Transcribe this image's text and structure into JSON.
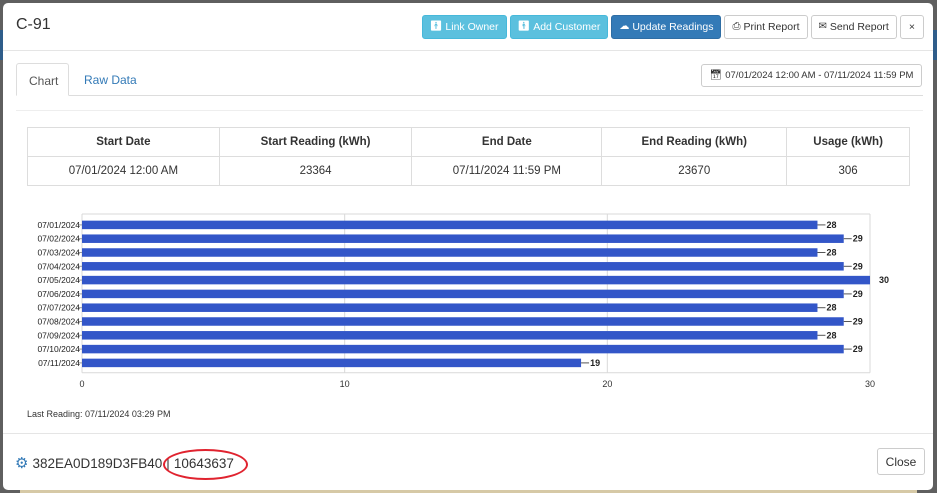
{
  "modal": {
    "title": "C-91"
  },
  "header_buttons": {
    "link_owner": "Link Owner",
    "add_customer": "Add Customer",
    "update_readings": "Update Readings",
    "print_report": "Print Report",
    "send_report": "Send Report",
    "close_x": "×"
  },
  "tabs": [
    {
      "label": "Chart",
      "active": true
    },
    {
      "label": "Raw Data",
      "active": false
    }
  ],
  "date_range": "07/01/2024 12:00 AM - 07/11/2024 11:59 PM",
  "summary": {
    "headers": [
      "Start Date",
      "Start Reading (kWh)",
      "End Date",
      "End Reading (kWh)",
      "Usage (kWh)"
    ],
    "row": [
      "07/01/2024 12:00 AM",
      "23364",
      "07/11/2024 11:59 PM",
      "23670",
      "306"
    ]
  },
  "chart_data": {
    "type": "bar",
    "orientation": "horizontal",
    "categories": [
      "07/01/2024",
      "07/02/2024",
      "07/03/2024",
      "07/04/2024",
      "07/05/2024",
      "07/06/2024",
      "07/07/2024",
      "07/08/2024",
      "07/09/2024",
      "07/10/2024",
      "07/11/2024"
    ],
    "values": [
      28,
      29,
      28,
      29,
      30,
      29,
      28,
      29,
      28,
      29,
      19
    ],
    "xlim": [
      0,
      30
    ],
    "xticks": [
      0,
      10,
      20,
      30
    ],
    "grid": true,
    "bar_color": "#3356c8"
  },
  "last_reading": "Last Reading: 07/11/2024 03:29 PM",
  "footer": {
    "device_id": "382EA0D189D3FB40",
    "separator": "|",
    "meter_number": "10643637",
    "close_label": "Close"
  },
  "colors": {
    "info": "#5bc0de",
    "primary": "#337ab7",
    "highlight": "#e0232f"
  }
}
